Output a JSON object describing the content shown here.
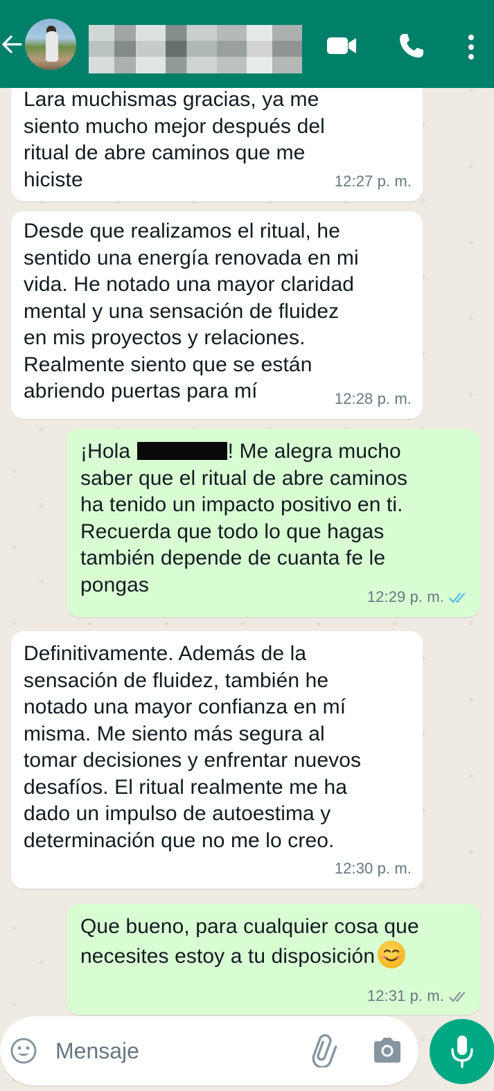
{
  "header": {
    "contact_name": "",
    "icons": [
      "back-arrow-icon",
      "avatar",
      "video-call-icon",
      "voice-call-icon",
      "more-options-icon"
    ],
    "bar_color": "#008069"
  },
  "messages": [
    {
      "direction": "in",
      "text": "Lara muchismas gracias, ya me\nsiento mucho mejor después del\nritual de abre caminos que me\nhiciste",
      "time": "12:27 p. m."
    },
    {
      "direction": "in",
      "text": "Desde que realizamos el ritual, he\nsentido una energía renovada en mi\nvida. He notado una mayor claridad\nmental y una sensación de fluidez\nen mis proyectos y relaciones.\nRealmente siento que se están\nabriendo puertas para mí",
      "time": "12:28 p. m."
    },
    {
      "direction": "out",
      "text_before": "¡Hola ",
      "text_after": "! Me alegra mucho\nsaber que el ritual de abre caminos\nha tenido un impacto positivo en ti.\nRecuerda que todo lo que hagas\ntambién depende de cuanta fe le\npongas",
      "time": "12:29 p. m.",
      "status": "read",
      "tick_color": "#53bdeb"
    },
    {
      "direction": "in",
      "text": "Definitivamente. Además de la\nsensación de fluidez, también he\nnotado una mayor confianza en mí\nmisma. Me siento más segura al\ntomar decisiones y enfrentar nuevos\ndesafíos. El ritual realmente me ha\ndado un impulso de autoestima y\ndeterminación que no me lo creo.",
      "time": "12:30 p. m."
    },
    {
      "direction": "out",
      "text": "Que bueno, para cualquier cosa que\nnecesites estoy a tu disposición",
      "emoji": "smiling-face-icon",
      "time": "12:31 p. m.",
      "status": "delivered",
      "tick_color": "#8696a0"
    }
  ],
  "composer": {
    "placeholder": "Mensaje",
    "icons": [
      "emoji-icon",
      "attach-icon",
      "camera-icon",
      "mic-icon"
    ],
    "accent": "#00a884"
  },
  "colors": {
    "chat_bg": "#efeae2",
    "incoming": "#ffffff",
    "outgoing": "#d9fdd3",
    "meta": "#667781"
  }
}
